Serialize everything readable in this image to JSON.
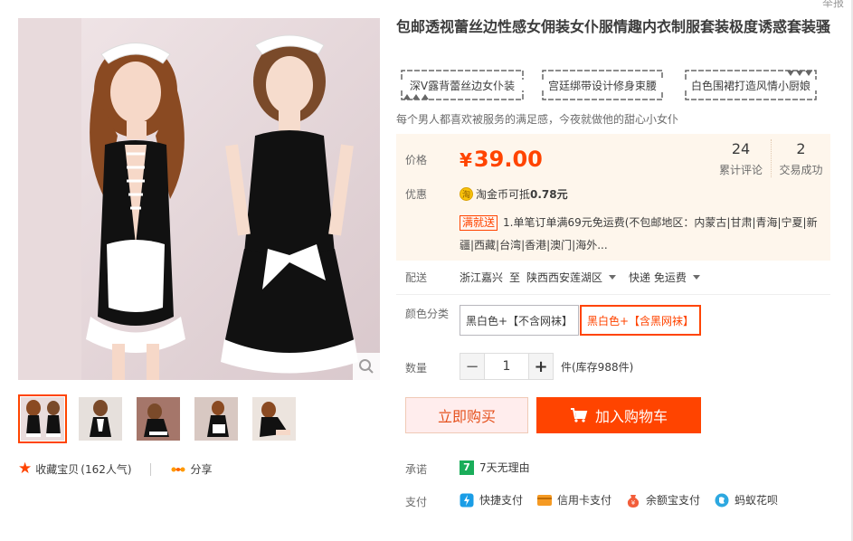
{
  "top_right_text": "举报",
  "product": {
    "title": "包邮透视蕾丝边性感女佣装女仆服情趣内衣制服套装极度诱惑套装骚",
    "tags": [
      "深V露背蕾丝边女仆装",
      "宫廷绑带设计修身束腰",
      "白色围裙打造风情小厨娘"
    ],
    "subtitle": "每个男人都喜欢被服务的满足感，今夜就做他的甜心小女仆"
  },
  "price": {
    "label": "价格",
    "currency": "¥",
    "value": "39.00",
    "reviews_count": "24",
    "reviews_label": "累计评论",
    "sales_count": "2",
    "sales_label": "交易成功"
  },
  "promo": {
    "label": "优惠",
    "coin_text": "淘金币可抵",
    "coin_amount": "0.78元",
    "badge": "满就送",
    "shipping_text": "1.单笔订单满69元免运费(不包邮地区：内蒙古|甘肃|青海|宁夏|新疆|西藏|台湾|香港|澳门|海外..."
  },
  "delivery": {
    "label": "配送",
    "from": "浙江嘉兴",
    "to_word": "至",
    "destination": "陕西西安莲湖区",
    "method": "快递 免运费"
  },
  "color": {
    "label": "颜色分类",
    "options": [
      "黑白色+【不含网袜】",
      "黑白色+【含黑网袜】"
    ],
    "selected_index": 1
  },
  "quantity": {
    "label": "数量",
    "minus": "−",
    "value": "1",
    "plus": "+",
    "stock": "件(库存988件)"
  },
  "actions": {
    "buy_now": "立即购买",
    "add_to_cart": "加入购物车"
  },
  "favorite": {
    "label": "收藏宝贝",
    "count": "(162人气)",
    "share": "分享"
  },
  "promise": {
    "label": "承诺",
    "badge": "7",
    "text": "7天无理由"
  },
  "payment": {
    "label": "支付",
    "methods": [
      "快捷支付",
      "信用卡支付",
      "余额宝支付",
      "蚂蚁花呗"
    ]
  },
  "colors": {
    "accent": "#ff4400",
    "price_bg": "#fef6ec",
    "buy_bg": "#ffeded"
  }
}
